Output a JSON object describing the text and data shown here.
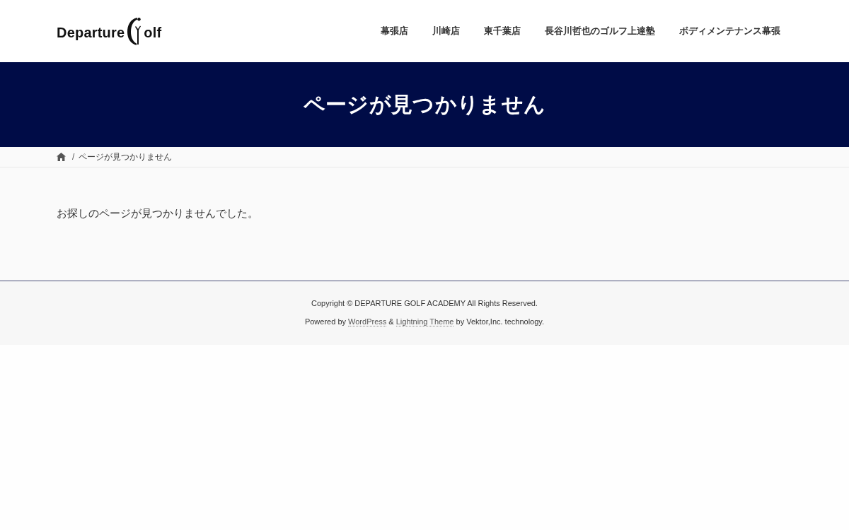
{
  "header": {
    "logo": {
      "parts": [
        "Departure",
        "olf"
      ]
    },
    "nav": [
      "幕張店",
      "川崎店",
      "東千葉店",
      "長谷川哲也のゴルフ上達塾",
      "ボディメンテナンス幕張"
    ]
  },
  "page_title": "ページが見つかりません",
  "breadcrumb": {
    "separator": "/",
    "current": "ページが見つかりません"
  },
  "message": "お探しのページが見つかりませんでした。",
  "footer": {
    "copyright": "Copyright © DEPARTURE GOLF ACADEMY All Rights Reserved.",
    "powered_by": [
      {
        "kind": "text",
        "text": "Powered by "
      },
      {
        "kind": "link",
        "text": "WordPress"
      },
      {
        "kind": "text",
        "text": " & "
      },
      {
        "kind": "link",
        "text": "Lightning Theme"
      },
      {
        "kind": "text",
        "text": " by Vektor,Inc. technology."
      }
    ]
  }
}
